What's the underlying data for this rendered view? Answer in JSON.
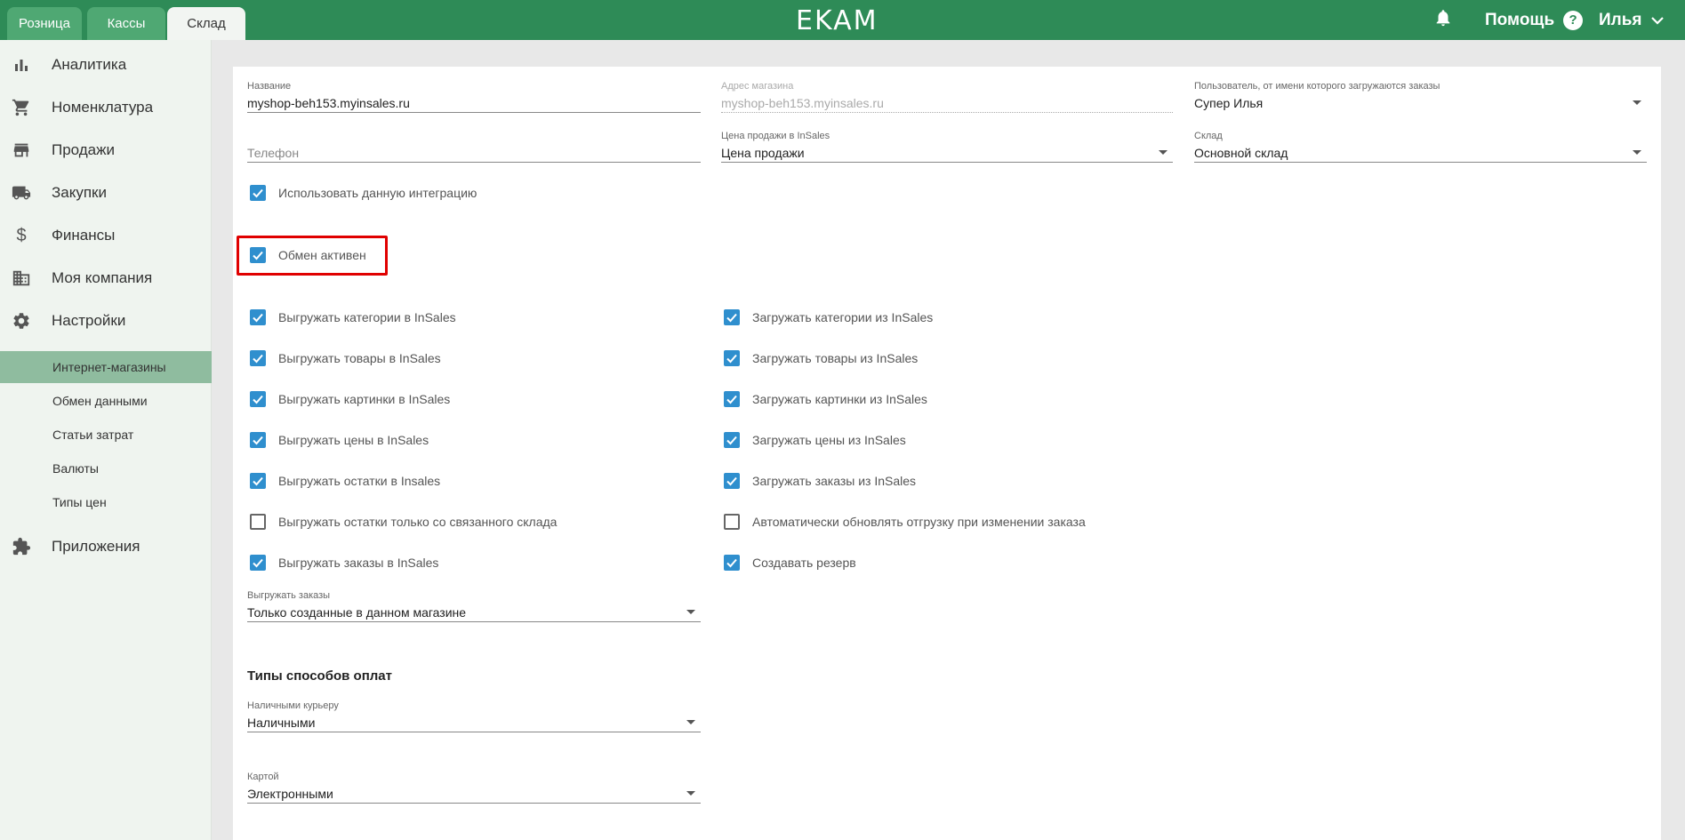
{
  "topbar": {
    "tabs": [
      {
        "label": "Розница"
      },
      {
        "label": "Кассы"
      },
      {
        "label": "Склад"
      }
    ],
    "logo": "EKAM",
    "help_label": "Помощь",
    "help_glyph": "?",
    "user_name": "Илья",
    "accent_color": "#2e8b57"
  },
  "sidebar": {
    "items": [
      {
        "label": "Аналитика",
        "icon": "bar-chart-icon"
      },
      {
        "label": "Номенклатура",
        "icon": "cart-icon"
      },
      {
        "label": "Продажи",
        "icon": "store-icon"
      },
      {
        "label": "Закупки",
        "icon": "truck-icon"
      },
      {
        "label": "Финансы",
        "icon": "dollar-icon"
      },
      {
        "label": "Моя компания",
        "icon": "building-icon"
      },
      {
        "label": "Настройки",
        "icon": "gear-icon"
      }
    ],
    "sub_items": [
      {
        "label": "Интернет-магазины",
        "active": true
      },
      {
        "label": "Обмен данными"
      },
      {
        "label": "Статьи затрат"
      },
      {
        "label": "Валюты"
      },
      {
        "label": "Типы цен"
      }
    ],
    "apps_label": "Приложения"
  },
  "form": {
    "name": {
      "label": "Название",
      "value": "myshop-beh153.myinsales.ru"
    },
    "shop_address": {
      "label": "Адрес магазина",
      "value": "myshop-beh153.myinsales.ru"
    },
    "user": {
      "label": "Пользователь, от имени которого загружаются заказы",
      "value": "Супер Илья"
    },
    "phone": {
      "placeholder": "Телефон"
    },
    "price": {
      "label": "Цена продажи в InSales",
      "value": "Цена продажи"
    },
    "warehouse": {
      "label": "Склад",
      "value": "Основной склад"
    },
    "use_integration": {
      "label": "Использовать данную интеграцию",
      "checked": true
    },
    "exchange_active": {
      "label": "Обмен активен",
      "checked": true
    },
    "left_checks": [
      {
        "label": "Выгружать категории в InSales",
        "checked": true
      },
      {
        "label": "Выгружать товары в InSales",
        "checked": true
      },
      {
        "label": "Выгружать картинки в InSales",
        "checked": true
      },
      {
        "label": "Выгружать цены в InSales",
        "checked": true
      },
      {
        "label": "Выгружать остатки в Insales",
        "checked": true
      },
      {
        "label": "Выгружать остатки только со связанного склада",
        "checked": false
      },
      {
        "label": "Выгружать заказы в InSales",
        "checked": true
      }
    ],
    "right_checks": [
      {
        "label": "Загружать категории из InSales",
        "checked": true
      },
      {
        "label": "Загружать товары из InSales",
        "checked": true
      },
      {
        "label": "Загружать картинки из InSales",
        "checked": true
      },
      {
        "label": "Загружать цены из InSales",
        "checked": true
      },
      {
        "label": "Загружать заказы из InSales",
        "checked": true
      },
      {
        "label": "Автоматически обновлять отгрузку при изменении заказа",
        "checked": false
      },
      {
        "label": "Создавать резерв",
        "checked": true
      }
    ],
    "export_orders": {
      "label": "Выгружать заказы",
      "value": "Только созданные в данном магазине"
    },
    "payment_section_title": "Типы способов оплат",
    "cash_courier": {
      "label": "Наличными курьеру",
      "value": "Наличными"
    },
    "card": {
      "label": "Картой",
      "value": "Электронными"
    }
  }
}
